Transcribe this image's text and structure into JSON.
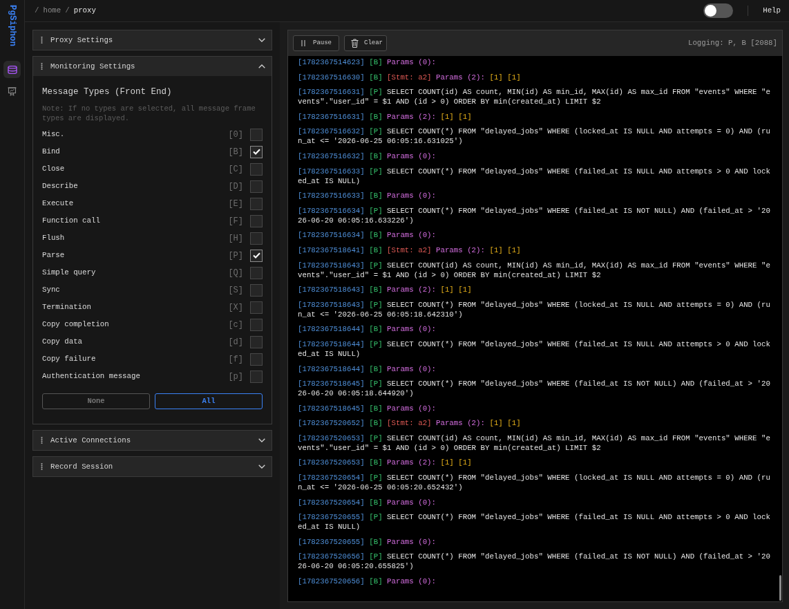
{
  "sidebar": {
    "logo": "PgSiphon",
    "items": [
      {
        "kind": "database",
        "selected": true
      },
      {
        "kind": "presentation",
        "selected": false
      }
    ]
  },
  "breadcrumb": [
    {
      "kind": "separator",
      "text": "/"
    },
    {
      "kind": "link",
      "text": "home"
    },
    {
      "kind": "separator",
      "text": "/"
    },
    {
      "kind": "current",
      "text": "proxy"
    }
  ],
  "header": {
    "toggle": {
      "on": false
    },
    "help": "Help"
  },
  "sections": [
    {
      "title": "Proxy Settings",
      "expanded": false
    },
    {
      "title": "Monitoring Settings",
      "expanded": true,
      "content": {
        "heading": "Message Types (Front End)",
        "note": "Note: If no types are selected, all message frame types are displayed.",
        "message_types": [
          {
            "label": "Misc.",
            "code": "[0]",
            "checked": false
          },
          {
            "label": "Bind",
            "code": "[B]",
            "checked": true
          },
          {
            "label": "Close",
            "code": "[C]",
            "checked": false
          },
          {
            "label": "Describe",
            "code": "[D]",
            "checked": false
          },
          {
            "label": "Execute",
            "code": "[E]",
            "checked": false
          },
          {
            "label": "Function call",
            "code": "[F]",
            "checked": false
          },
          {
            "label": "Flush",
            "code": "[H]",
            "checked": false
          },
          {
            "label": "Parse",
            "code": "[P]",
            "checked": true
          },
          {
            "label": "Simple query",
            "code": "[Q]",
            "checked": false
          },
          {
            "label": "Sync",
            "code": "[S]",
            "checked": false
          },
          {
            "label": "Termination",
            "code": "[X]",
            "checked": false
          },
          {
            "label": "Copy completion",
            "code": "[c]",
            "checked": false
          },
          {
            "label": "Copy data",
            "code": "[d]",
            "checked": false
          },
          {
            "label": "Copy failure",
            "code": "[f]",
            "checked": false
          },
          {
            "label": "Authentication message",
            "code": "[p]",
            "checked": false
          }
        ],
        "buttons": [
          {
            "kind": "secondary",
            "label": "None"
          },
          {
            "kind": "primary",
            "label": "All"
          }
        ]
      }
    },
    {
      "title": "Active Connections",
      "expanded": false
    },
    {
      "title": "Record Session",
      "expanded": false
    }
  ],
  "log_panel": {
    "buttons": [
      {
        "kind": "pause",
        "label": "Pause"
      },
      {
        "kind": "clear",
        "label": "Clear"
      }
    ],
    "status": "Logging: P, B [2088]",
    "entries": [
      {
        "timestamp": "[1782367514623]",
        "tag": "[B]",
        "params": "Params (0):"
      },
      {
        "timestamp": "[1782367516630]",
        "tag": "[B]",
        "statement": "[Stmt: a2]",
        "params": "Params (2):",
        "values": [
          "[1]",
          "[1]"
        ]
      },
      {
        "timestamp": "[1782367516631]",
        "tag": "[P]",
        "sql": "SELECT COUNT(id) AS count, MIN(id) AS min_id, MAX(id) AS max_id FROM \"events\" WHERE \"events\".\"user_id\" = $1 AND (id > 0) ORDER BY min(created_at) LIMIT $2"
      },
      {
        "timestamp": "[1782367516631]",
        "tag": "[B]",
        "params": "Params (2):",
        "values": [
          "[1]",
          "[1]"
        ]
      },
      {
        "timestamp": "[1782367516632]",
        "tag": "[P]",
        "sql": "SELECT COUNT(*) FROM \"delayed_jobs\" WHERE (locked_at IS NULL AND attempts = 0) AND (run_at <= '2026-06-25 06:05:16.631025')"
      },
      {
        "timestamp": "[1782367516632]",
        "tag": "[B]",
        "params": "Params (0):"
      },
      {
        "timestamp": "[1782367516633]",
        "tag": "[P]",
        "sql": "SELECT COUNT(*) FROM \"delayed_jobs\" WHERE (failed_at IS NULL AND attempts > 0 AND locked_at IS NULL)"
      },
      {
        "timestamp": "[1782367516633]",
        "tag": "[B]",
        "params": "Params (0):"
      },
      {
        "timestamp": "[1782367516634]",
        "tag": "[P]",
        "sql": "SELECT COUNT(*) FROM \"delayed_jobs\" WHERE (failed_at IS NOT NULL) AND (failed_at > '2026-06-20 06:05:16.633226')"
      },
      {
        "timestamp": "[1782367516634]",
        "tag": "[B]",
        "params": "Params (0):"
      },
      {
        "timestamp": "[1782367518641]",
        "tag": "[B]",
        "statement": "[Stmt: a2]",
        "params": "Params (2):",
        "values": [
          "[1]",
          "[1]"
        ]
      },
      {
        "timestamp": "[1782367518643]",
        "tag": "[P]",
        "sql": "SELECT COUNT(id) AS count, MIN(id) AS min_id, MAX(id) AS max_id FROM \"events\" WHERE \"events\".\"user_id\" = $1 AND (id > 0) ORDER BY min(created_at) LIMIT $2"
      },
      {
        "timestamp": "[1782367518643]",
        "tag": "[B]",
        "params": "Params (2):",
        "values": [
          "[1]",
          "[1]"
        ]
      },
      {
        "timestamp": "[1782367518643]",
        "tag": "[P]",
        "sql": "SELECT COUNT(*) FROM \"delayed_jobs\" WHERE (locked_at IS NULL AND attempts = 0) AND (run_at <= '2026-06-25 06:05:18.642310')"
      },
      {
        "timestamp": "[1782367518644]",
        "tag": "[B]",
        "params": "Params (0):"
      },
      {
        "timestamp": "[1782367518644]",
        "tag": "[P]",
        "sql": "SELECT COUNT(*) FROM \"delayed_jobs\" WHERE (failed_at IS NULL AND attempts > 0 AND locked_at IS NULL)"
      },
      {
        "timestamp": "[1782367518644]",
        "tag": "[B]",
        "params": "Params (0):"
      },
      {
        "timestamp": "[1782367518645]",
        "tag": "[P]",
        "sql": "SELECT COUNT(*) FROM \"delayed_jobs\" WHERE (failed_at IS NOT NULL) AND (failed_at > '2026-06-20 06:05:18.644920')"
      },
      {
        "timestamp": "[1782367518645]",
        "tag": "[B]",
        "params": "Params (0):"
      },
      {
        "timestamp": "[1782367520652]",
        "tag": "[B]",
        "statement": "[Stmt: a2]",
        "params": "Params (2):",
        "values": [
          "[1]",
          "[1]"
        ]
      },
      {
        "timestamp": "[1782367520653]",
        "tag": "[P]",
        "sql": "SELECT COUNT(id) AS count, MIN(id) AS min_id, MAX(id) AS max_id FROM \"events\" WHERE \"events\".\"user_id\" = $1 AND (id > 0) ORDER BY min(created_at) LIMIT $2"
      },
      {
        "timestamp": "[1782367520653]",
        "tag": "[B]",
        "params": "Params (2):",
        "values": [
          "[1]",
          "[1]"
        ]
      },
      {
        "timestamp": "[1782367520654]",
        "tag": "[P]",
        "sql": "SELECT COUNT(*) FROM \"delayed_jobs\" WHERE (locked_at IS NULL AND attempts = 0) AND (run_at <= '2026-06-25 06:05:20.652432')"
      },
      {
        "timestamp": "[1782367520654]",
        "tag": "[B]",
        "params": "Params (0):"
      },
      {
        "timestamp": "[1782367520655]",
        "tag": "[P]",
        "sql": "SELECT COUNT(*) FROM \"delayed_jobs\" WHERE (failed_at IS NULL AND attempts > 0 AND locked_at IS NULL)"
      },
      {
        "timestamp": "[1782367520655]",
        "tag": "[B]",
        "params": "Params (0):"
      },
      {
        "timestamp": "[1782367520656]",
        "tag": "[P]",
        "sql": "SELECT COUNT(*) FROM \"delayed_jobs\" WHERE (failed_at IS NOT NULL) AND (failed_at > '2026-06-20 06:05:20.655825')"
      },
      {
        "timestamp": "[1782367520656]",
        "tag": "[B]",
        "params": "Params (0):"
      }
    ]
  }
}
